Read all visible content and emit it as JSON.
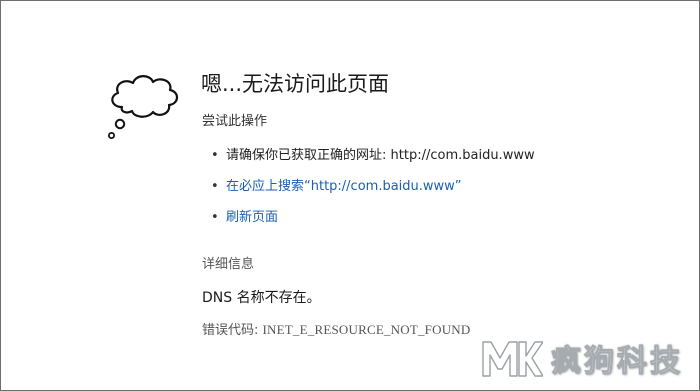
{
  "page": {
    "title": "嗯...无法访问此页面",
    "subtitle": "尝试此操作"
  },
  "suggestions": [
    {
      "text": "请确保你已获取正确的网址: http://com.baidu.www",
      "type": "plain"
    },
    {
      "text": "在必应上搜索“http://com.baidu.www”",
      "type": "link"
    },
    {
      "text": "刷新页面",
      "type": "link"
    }
  ],
  "bullet": "•",
  "details": {
    "heading": "详细信息",
    "message": "DNS 名称不存在。",
    "error_label": "错误代码: ",
    "error_code": "INET_E_RESOURCE_NOT_FOUND"
  },
  "watermark": {
    "text": "疯狗科技",
    "logo_text": "MK"
  },
  "colors": {
    "link": "#1a5fb4",
    "text": "#1a1a1a",
    "muted": "#555555",
    "border": "#6e6e6e"
  },
  "icons": {
    "cloud": "thought-cloud-icon"
  }
}
